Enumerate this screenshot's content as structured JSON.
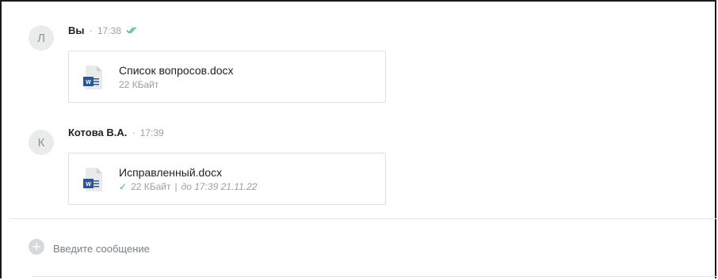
{
  "messages": [
    {
      "avatar_letter": "Л",
      "author": "Вы",
      "time": "17:38",
      "read_icon": "double-check-icon",
      "file": {
        "name": "Список вопросов.docx",
        "size": "22 КБайт",
        "icon": "word-document-icon"
      }
    },
    {
      "avatar_letter": "К",
      "author": "Котова В.А.",
      "time": "17:39",
      "file": {
        "name": "Исправленный.docx",
        "check": "✓",
        "size": "22 КБайт",
        "separator": "|",
        "expires": "до 17:39 21.11.22",
        "icon": "word-document-icon"
      }
    }
  ],
  "composer": {
    "placeholder": "Введите сообщение",
    "value": ""
  },
  "colors": {
    "accent_check": "#3bb99a",
    "word_blue": "#2b5797",
    "muted": "#9aa0a6"
  }
}
